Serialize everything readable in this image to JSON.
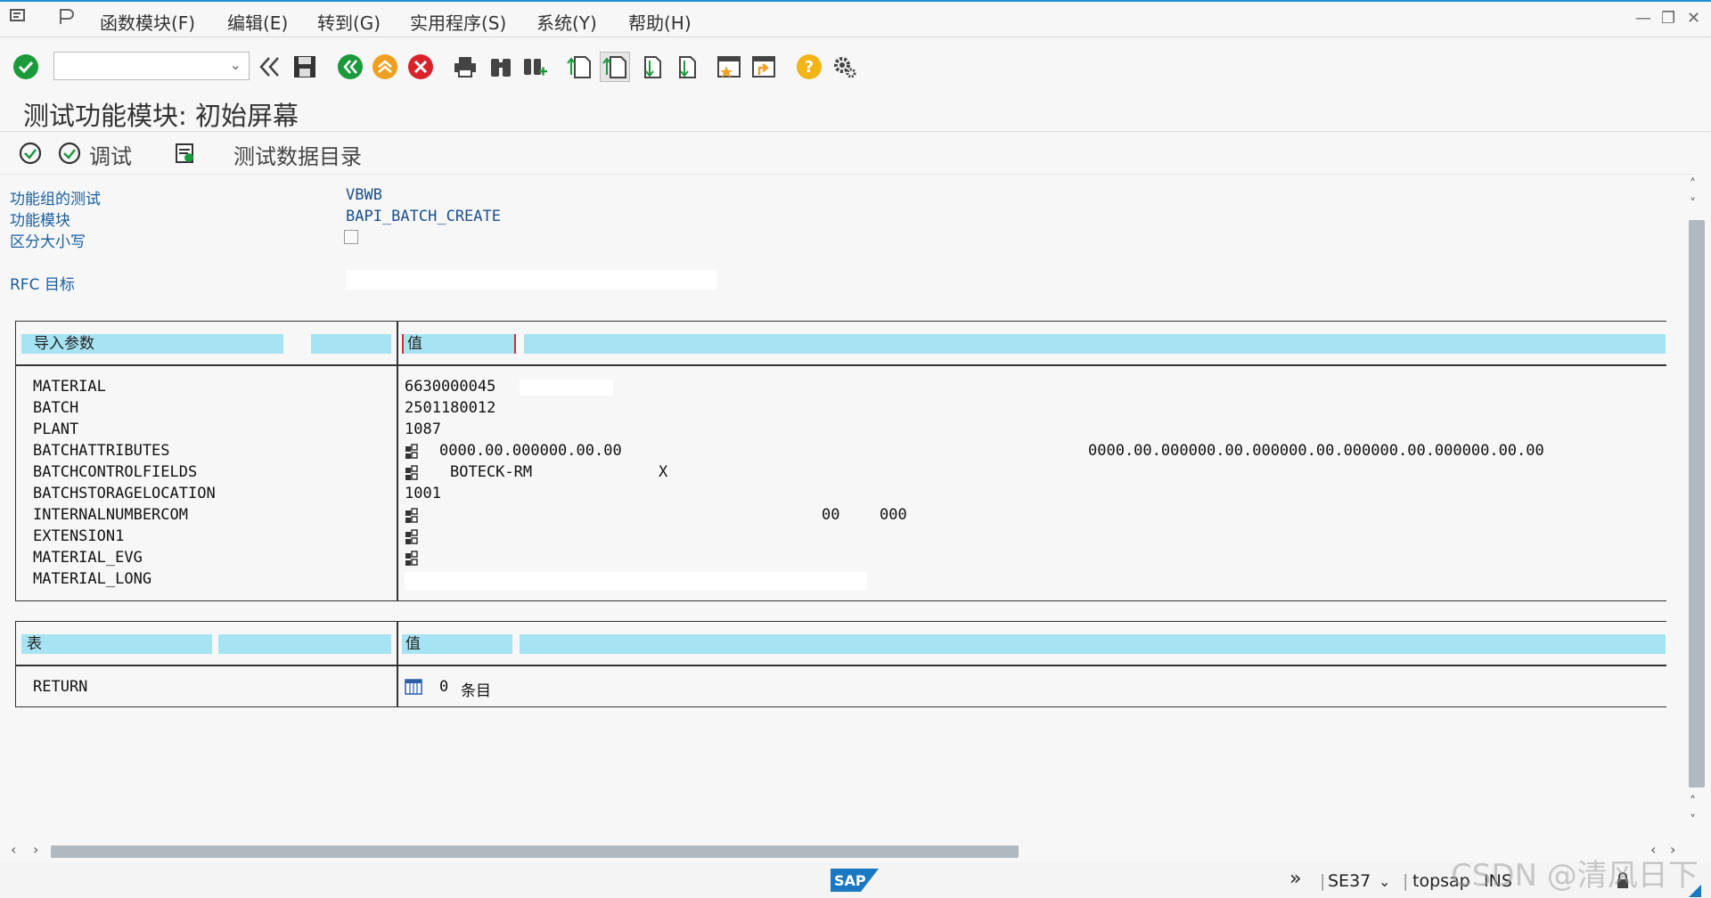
{
  "menu": {
    "items": [
      "函数模块(F)",
      "编辑(E)",
      "转到(G)",
      "实用程序(S)",
      "系统(Y)",
      "帮助(H)"
    ]
  },
  "toolbar": {
    "command_value": ""
  },
  "page": {
    "title": "测试功能模块: 初始屏幕"
  },
  "appbar": {
    "debug_label": "调试",
    "test_dir_label": "测试数据目录"
  },
  "fields": {
    "group_label": "功能组的测试",
    "group_value": "VBWB",
    "module_label": "功能模块",
    "module_value": "BAPI_BATCH_CREATE",
    "case_label": "区分大小写",
    "rfc_label": "RFC 目标"
  },
  "import_table": {
    "header_param": "导入参数",
    "header_value": "值",
    "rows": [
      {
        "name": "MATERIAL",
        "value": "6630000045",
        "extra": ""
      },
      {
        "name": "BATCH",
        "value": "2501180012",
        "extra": ""
      },
      {
        "name": "PLANT",
        "value": "1087",
        "extra": ""
      },
      {
        "name": "BATCHATTRIBUTES",
        "value": "0000.00.000000.00.00",
        "extra": "0000.00.000000.00.000000.00.000000.00.000000.00.00"
      },
      {
        "name": "BATCHCONTROLFIELDS",
        "value": "BOTECK-RM",
        "extra": "X"
      },
      {
        "name": "BATCHSTORAGELOCATION",
        "value": "1001",
        "extra": ""
      },
      {
        "name": "INTERNALNUMBERCOM",
        "value": "00",
        "extra": "000"
      },
      {
        "name": "EXTENSION1",
        "value": "",
        "extra": ""
      },
      {
        "name": "MATERIAL_EVG",
        "value": "",
        "extra": ""
      },
      {
        "name": "MATERIAL_LONG",
        "value": "",
        "extra": ""
      }
    ]
  },
  "tables_table": {
    "header_param": "表",
    "header_value": "值",
    "rows": [
      {
        "name": "RETURN",
        "count": "0",
        "unit": "条目"
      }
    ]
  },
  "status": {
    "tcode": "SE37",
    "system": "topsap",
    "mode": "INS",
    "watermark": "CSDN @清风日下",
    "logo": "SAP"
  }
}
